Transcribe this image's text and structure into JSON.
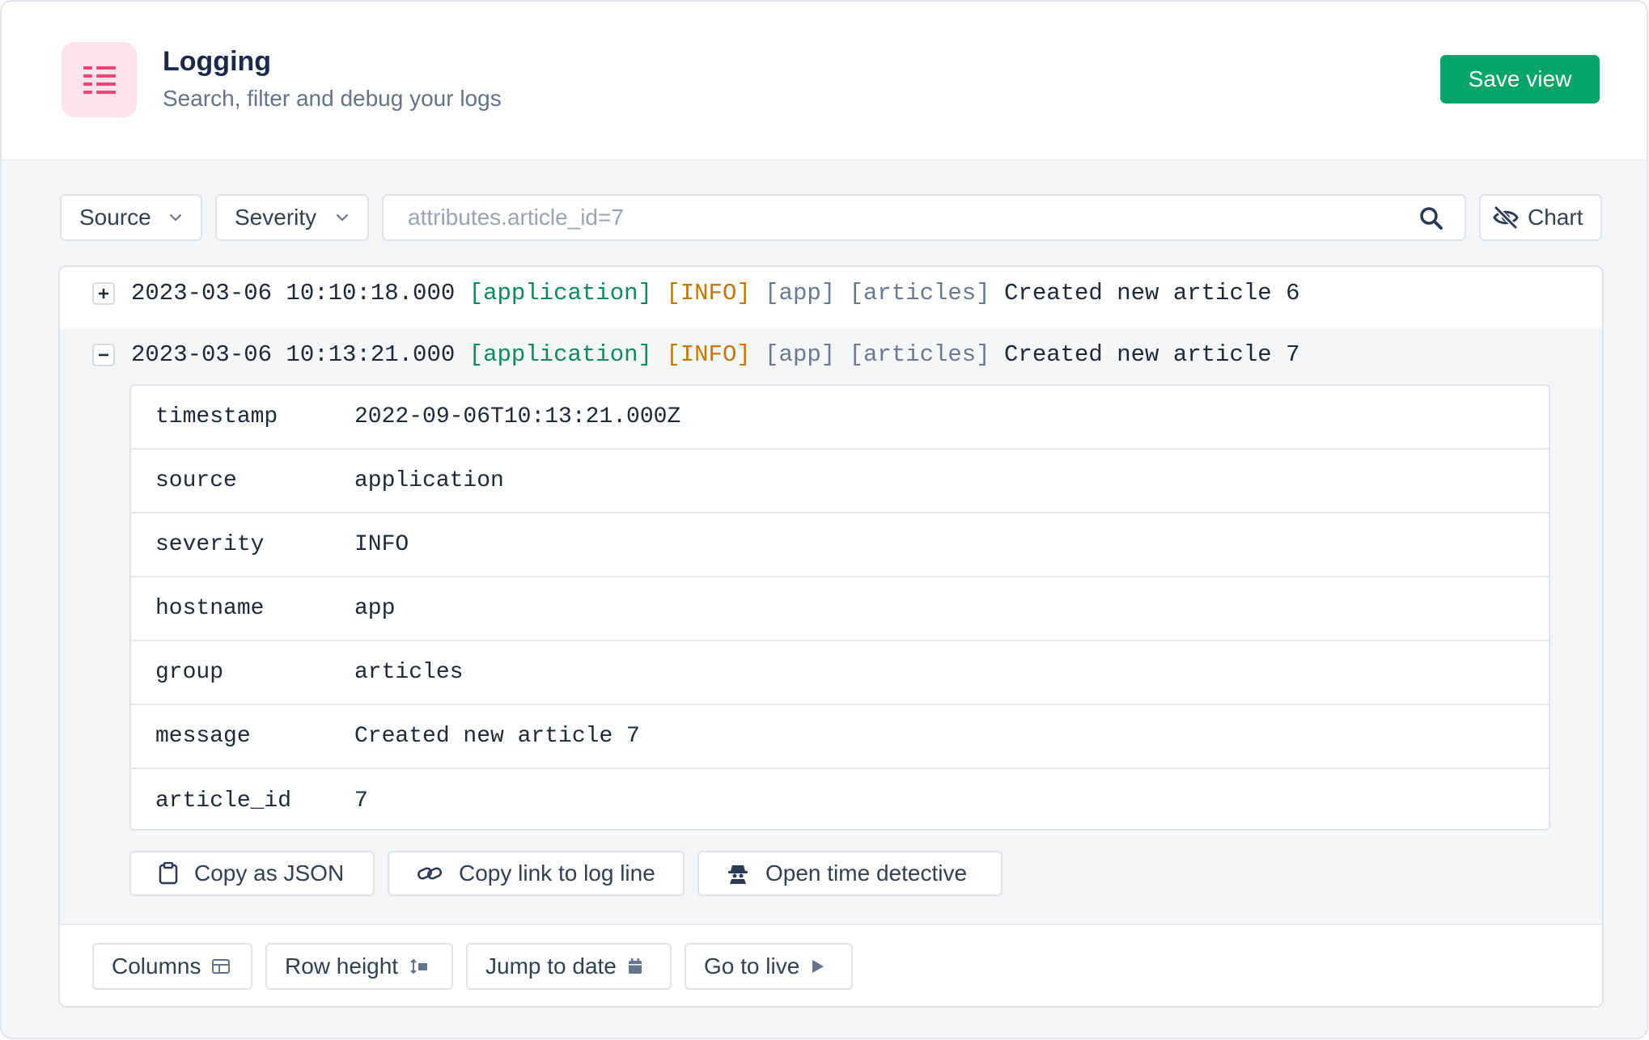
{
  "header": {
    "title": "Logging",
    "subtitle": "Search, filter and debug your logs",
    "save_label": "Save view",
    "icon": "list-icon"
  },
  "filters": {
    "source_label": "Source",
    "severity_label": "Severity",
    "search_placeholder": "attributes.article_id=7",
    "chart_label": "Chart"
  },
  "logs": [
    {
      "timestamp": "2023-03-06 10:10:18.000",
      "source": "[application]",
      "severity": "[INFO]",
      "host": "[app]",
      "group": "[articles]",
      "message": "Created new article 6",
      "expanded": false
    },
    {
      "timestamp": "2023-03-06 10:13:21.000",
      "source": "[application]",
      "severity": "[INFO]",
      "host": "[app]",
      "group": "[articles]",
      "message": "Created new article 7",
      "expanded": true
    }
  ],
  "details": [
    {
      "key": "timestamp",
      "value": "2022-09-06T10:13:21.000Z"
    },
    {
      "key": "source",
      "value": "application"
    },
    {
      "key": "severity",
      "value": "INFO"
    },
    {
      "key": "hostname",
      "value": "app"
    },
    {
      "key": "group",
      "value": "articles"
    },
    {
      "key": "message",
      "value": "Created new article 7"
    },
    {
      "key": "article_id",
      "value": "7"
    }
  ],
  "actions": {
    "copy_json": "Copy as JSON",
    "copy_link": "Copy link to log line",
    "time_detective": "Open time detective"
  },
  "footer": {
    "columns": "Columns",
    "row_height": "Row height",
    "jump_to_date": "Jump to date",
    "go_to_live": "Go to live"
  },
  "colors": {
    "accent": "#04a46a",
    "source": "#0d8a5f",
    "severity_info": "#c5780a",
    "meta": "#6b7a93",
    "icon_pink": "#f0457a"
  }
}
